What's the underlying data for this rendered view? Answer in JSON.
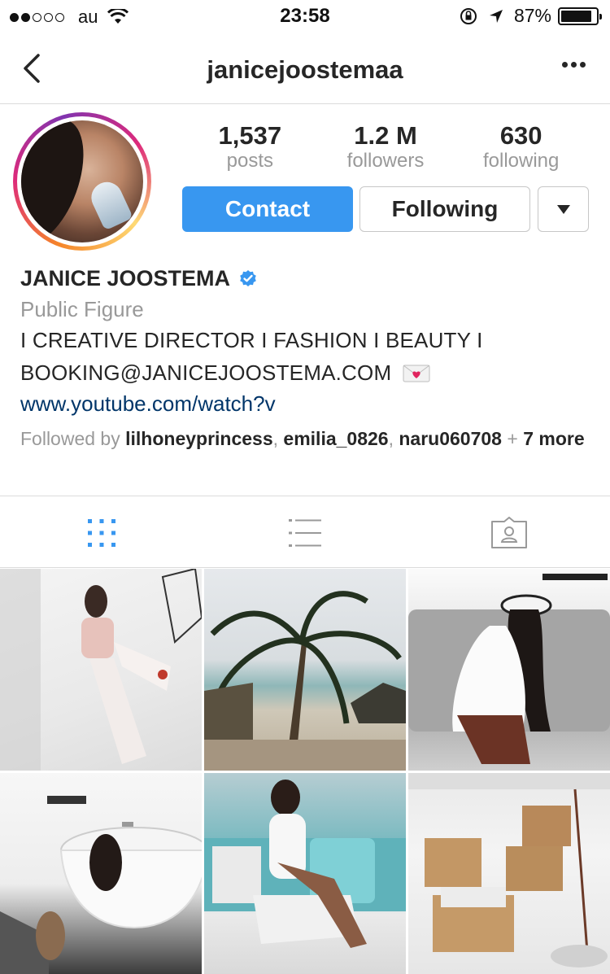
{
  "status_bar": {
    "carrier": "au",
    "time": "23:58",
    "battery_text": "87%",
    "battery_level": 0.87,
    "signal_bars": 2,
    "signal_total": 5
  },
  "nav": {
    "title": "janicejoostemaa",
    "back_icon": "chevron-left-icon",
    "more_icon": "more-horizontal-icon"
  },
  "profile": {
    "stats": [
      {
        "value": "1,537",
        "label": "posts"
      },
      {
        "value": "1.2 M",
        "label": "followers"
      },
      {
        "value": "630",
        "label": "following"
      }
    ],
    "buttons": {
      "contact": "Contact",
      "following": "Following"
    },
    "name": "JANICE JOOSTEMA",
    "category": "Public Figure",
    "bio_line1": "I CREATIVE DIRECTOR I FASHION I BEAUTY I",
    "bio_line2": "BOOKING@JANICEJOOSTEMA.COM",
    "link": "www.youtube.com/watch?v",
    "followed_prefix": "Followed by ",
    "followed_users": [
      "lilhoneyprincess",
      "emilia_0826",
      "naru060708"
    ],
    "followed_suffix": " + 7 more"
  },
  "tabs": [
    {
      "name": "grid",
      "icon": "grid-icon",
      "active": true
    },
    {
      "name": "list",
      "icon": "list-icon",
      "active": false
    },
    {
      "name": "tagged",
      "icon": "tagged-person-icon",
      "active": false
    }
  ],
  "colors": {
    "accent": "#3897f0",
    "link": "#003569",
    "muted": "#999999",
    "text": "#262626"
  }
}
